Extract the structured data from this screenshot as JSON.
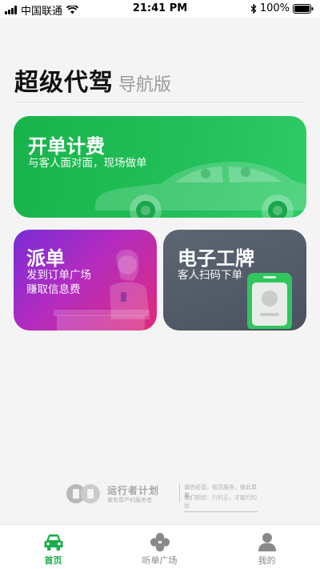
{
  "status_bar": {
    "carrier": "中国联通",
    "time": "21:41 PM",
    "battery": "100%"
  },
  "header": {
    "title": "超级代驾",
    "subtitle": "导航版"
  },
  "cards": {
    "billing": {
      "title": "开单计费",
      "subtitle": "与客人面对面，现场做单"
    },
    "dispatch": {
      "title": "派单",
      "line1": "发到订单广场",
      "line2": "赚取信息费"
    },
    "badge": {
      "title": "电子工牌",
      "subtitle": "客人扫码下单"
    }
  },
  "footer_logo": {
    "name": "运行者计划",
    "tagline": "做有尊严的服务者",
    "slogan1": "诚信经营，规范服务，彼此尊重",
    "slogan2": "我们相信：行的正，才能行的远"
  },
  "tabs": {
    "home": "首页",
    "orders": "听单广场",
    "mine": "我的"
  },
  "colors": {
    "accent_green": "#1aad4b",
    "card_green": "#22c05a",
    "card_purple": "#9a2ccd",
    "card_gray": "#555d6a"
  },
  "icons": [
    "wifi-icon",
    "bluetooth-icon",
    "battery-icon",
    "car-icon",
    "clover-icon",
    "person-icon"
  ]
}
